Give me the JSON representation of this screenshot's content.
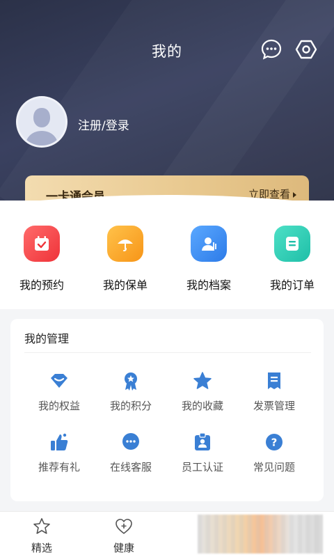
{
  "header": {
    "title": "我的",
    "icons": {
      "message": "message-dots-icon",
      "settings": "hexagon-settings-icon"
    }
  },
  "profile": {
    "login_label": "注册/登录",
    "avatar_icon": "default-avatar-icon"
  },
  "membership": {
    "title": "一卡通会员",
    "link": "立即查看"
  },
  "quick_actions": [
    {
      "label": "我的预约",
      "icon": "calendar-check-icon",
      "color": "#f2444a"
    },
    {
      "label": "我的保单",
      "icon": "umbrella-icon",
      "color": "#f7a51f"
    },
    {
      "label": "我的档案",
      "icon": "person-profile-icon",
      "color": "#3a8ff5"
    },
    {
      "label": "我的订单",
      "icon": "order-list-icon",
      "color": "#2bc9b4"
    }
  ],
  "management": {
    "title": "我的管理",
    "items": [
      {
        "label": "我的权益",
        "icon": "benefit-diamond-icon"
      },
      {
        "label": "我的积分",
        "icon": "medal-icon"
      },
      {
        "label": "我的收藏",
        "icon": "star-icon"
      },
      {
        "label": "发票管理",
        "icon": "invoice-icon"
      },
      {
        "label": "推荐有礼",
        "icon": "thumbs-up-icon"
      },
      {
        "label": "在线客服",
        "icon": "chat-bubble-icon"
      },
      {
        "label": "员工认证",
        "icon": "badge-id-icon"
      },
      {
        "label": "常见问题",
        "icon": "question-icon"
      }
    ],
    "icon_color": "#3a7fd4"
  },
  "bottom_nav": [
    {
      "label": "精选",
      "icon": "star-outline-icon"
    },
    {
      "label": "健康",
      "icon": "heart-plus-icon"
    }
  ]
}
